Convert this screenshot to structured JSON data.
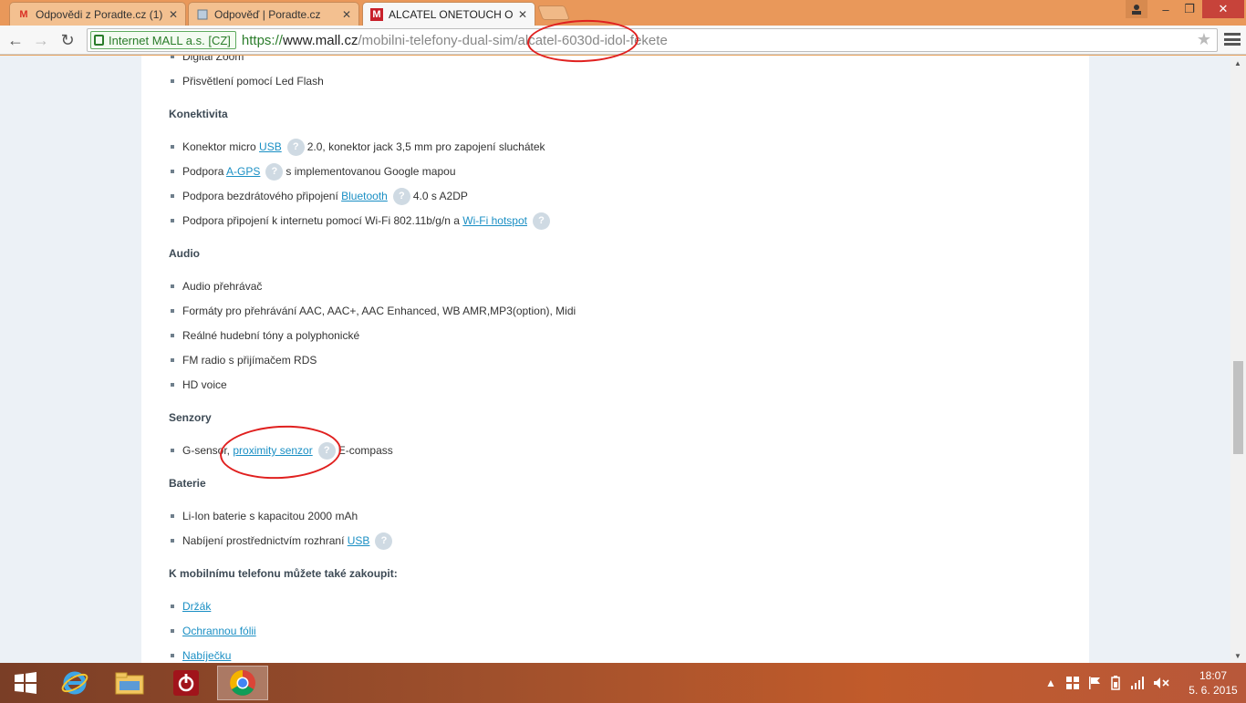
{
  "browser": {
    "tabs": [
      {
        "title": "Odpovědi z Poradte.cz (1)",
        "icon": "gmail-icon"
      },
      {
        "title": "Odpověď | Poradte.cz",
        "icon": "page-icon"
      },
      {
        "title": "ALCATEL ONETOUCH One",
        "icon": "mall-icon"
      }
    ],
    "address": {
      "ev_label": "Internet MALL a.s. [CZ]",
      "scheme": "https://",
      "host": "www.mall.cz",
      "path": "/mobilni-telefony-dual-sim/alcatel-6030d-idol-fekete"
    }
  },
  "content": {
    "top_cut_item": "Digital Zoom",
    "flash_item": "Přisvětlení pomocí Led Flash",
    "sections": {
      "connectivity": {
        "heading": "Konektivita",
        "usb": {
          "pre": "Konektor micro ",
          "link": "USB",
          "post": "2.0, konektor jack 3,5 mm pro zapojení sluchátek"
        },
        "agps": {
          "pre": "Podpora ",
          "link": "A-GPS",
          "post": "s implementovanou Google mapou"
        },
        "bt": {
          "pre": "Podpora bezdrátového připojení ",
          "link": "Bluetooth",
          "post": "4.0 s A2DP"
        },
        "wifi": {
          "pre": "Podpora připojení k internetu pomocí Wi-Fi 802.11b/g/n a ",
          "link": "Wi-Fi hotspot"
        }
      },
      "audio": {
        "heading": "Audio",
        "items": [
          "Audio přehrávač",
          "Formáty pro přehrávání AAC, AAC+, AAC Enhanced, WB AMR,MP3(option), Midi",
          "Reálné hudební tóny a polyphonické",
          "FM radio s přijímačem RDS",
          "HD voice"
        ]
      },
      "sensors": {
        "heading": "Senzory",
        "pre": "G-sensor, ",
        "link": "proximity senzor",
        "post": "E-compass"
      },
      "battery": {
        "heading": "Baterie",
        "item1": "Li-Ion baterie s kapacitou 2000 mAh",
        "charge_pre": "Nabíjení prostřednictvím rozhraní ",
        "charge_link": "USB"
      },
      "accessories": {
        "heading": "K mobilnímu telefonu můžete také zakoupit:",
        "links": [
          "Držák",
          "Ochrannou fólii",
          "Nabíječku"
        ]
      }
    },
    "help_glyph": "?"
  },
  "taskbar": {
    "time": "18:07",
    "date": "5. 6. 2015"
  }
}
